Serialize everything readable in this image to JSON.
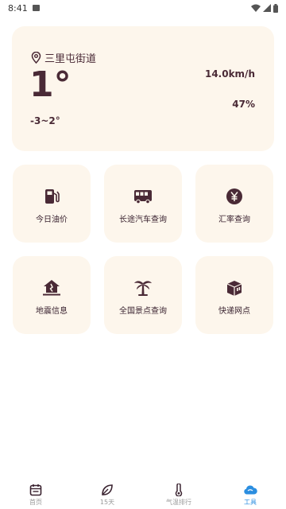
{
  "status_bar": {
    "time": "8:41"
  },
  "weather": {
    "location": "三里屯街道",
    "temperature": "1°",
    "range": "-3~2°",
    "wind_speed": "14.0km/h",
    "humidity": "47%"
  },
  "tools": [
    {
      "label": "今日油价",
      "icon": "fuel-pump-icon"
    },
    {
      "label": "长途汽车查询",
      "icon": "bus-icon"
    },
    {
      "label": "汇率查询",
      "icon": "yen-icon"
    },
    {
      "label": "地震信息",
      "icon": "earthquake-icon"
    },
    {
      "label": "全国景点查询",
      "icon": "palm-tree-icon"
    },
    {
      "label": "快递网点",
      "icon": "package-icon"
    }
  ],
  "nav": [
    {
      "label": "首页",
      "icon": "calendar-icon"
    },
    {
      "label": "15天",
      "icon": "leaf-icon"
    },
    {
      "label": "气温排行",
      "icon": "thermometer-icon"
    },
    {
      "label": "工具",
      "icon": "cloud-icon",
      "active": true
    }
  ],
  "colors": {
    "accent": "#4a2a36",
    "card_bg": "#fdf6ec",
    "active": "#2b8ee0"
  }
}
